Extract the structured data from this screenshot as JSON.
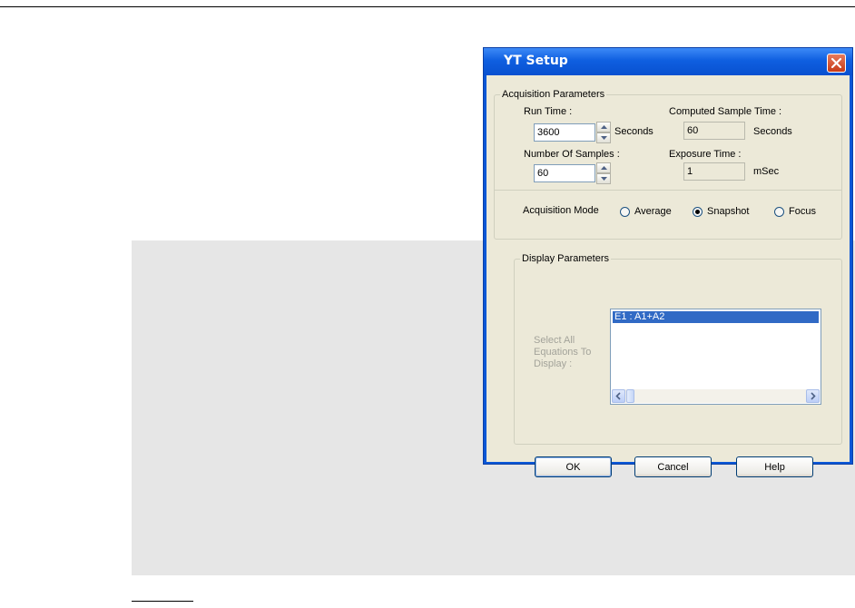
{
  "dialog": {
    "title": "YT Setup",
    "accent": "#0b57d6"
  },
  "acquisition": {
    "legend": "Acquisition Parameters",
    "run_time_label": "Run Time :",
    "run_time_value": "3600",
    "run_time_unit": "Seconds",
    "computed_label": "Computed Sample Time :",
    "computed_value": "60",
    "computed_unit": "Seconds",
    "samples_label": "Number Of Samples :",
    "samples_value": "60",
    "exposure_label": "Exposure Time :",
    "exposure_value": "1",
    "exposure_unit": "mSec",
    "mode_label": "Acquisition Mode",
    "modes": [
      {
        "label": "Average",
        "selected": false
      },
      {
        "label": "Snapshot",
        "selected": true
      },
      {
        "label": "Focus",
        "selected": false
      }
    ]
  },
  "display": {
    "legend": "Display Parameters",
    "select_label_1": "Select All",
    "select_label_2": "Equations To",
    "select_label_3": "Display :",
    "equations": [
      "E1 : A1+A2"
    ]
  },
  "buttons": {
    "ok": "OK",
    "cancel": "Cancel",
    "help": "Help"
  },
  "icons": {
    "close": "close-icon",
    "spin_up": "chevron-up-icon",
    "spin_down": "chevron-down-icon",
    "scroll_left": "chevron-left-icon",
    "scroll_right": "chevron-right-icon"
  }
}
